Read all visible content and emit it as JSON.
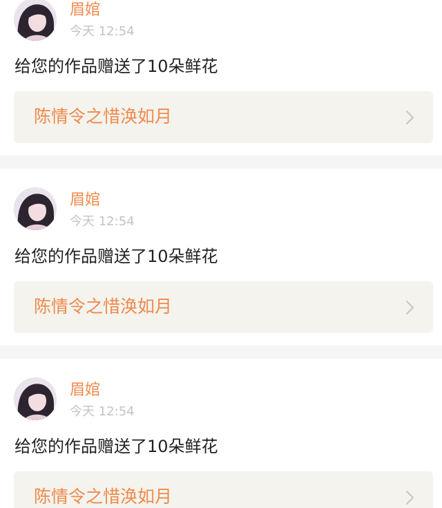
{
  "feed": {
    "notifications": [
      {
        "username": "眉婠",
        "time": "今天 12:54",
        "message": "给您的作品赠送了10朵鲜花",
        "work_title": "陈情令之惜涣如月"
      },
      {
        "username": "眉婠",
        "time": "今天 12:54",
        "message": "给您的作品赠送了10朵鲜花",
        "work_title": "陈情令之惜涣如月"
      },
      {
        "username": "眉婠",
        "time": "今天 12:54",
        "message": "给您的作品赠送了10朵鲜花",
        "work_title": "陈情令之惜涣如月"
      }
    ]
  },
  "icons": {
    "avatar": "avatar-photo",
    "chevron": "chevron-right-icon"
  },
  "colors": {
    "accent": "#f08a4b",
    "timestamp": "#c3c3c3",
    "message_text": "#222222",
    "link_background": "#f4f3ee",
    "separator": "#f5f5f5",
    "chevron": "#c8c8c8"
  }
}
